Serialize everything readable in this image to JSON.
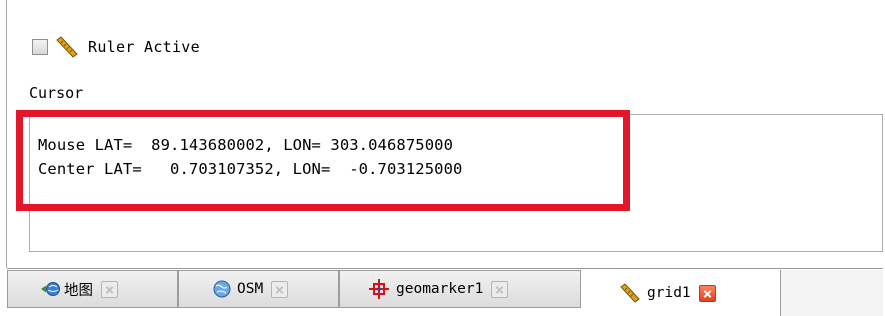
{
  "ruler": {
    "label": "Ruler Active",
    "checked": false,
    "icon": "ruler-icon"
  },
  "cursor": {
    "heading": "Cursor",
    "mouse_line": "Mouse LAT=  89.143680002, LON= 303.046875000",
    "center_line": "Center LAT=   0.703107352, LON=  -0.703125000"
  },
  "tabs": [
    {
      "label": "地图",
      "icon": "globe-arrow-icon",
      "active": false
    },
    {
      "label": "OSM",
      "icon": "globe-icon",
      "active": false
    },
    {
      "label": "geomarker1",
      "icon": "crosshair-icon",
      "active": false
    },
    {
      "label": "grid1",
      "icon": "ruler-icon",
      "active": true
    }
  ],
  "colors": {
    "highlight": "#e3172a",
    "close_active": "#e8401f"
  }
}
